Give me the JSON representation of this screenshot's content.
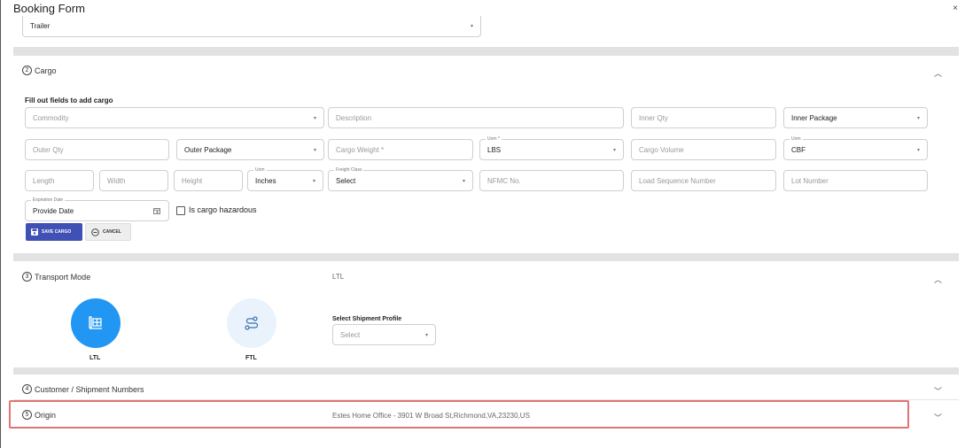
{
  "window": {
    "title": "Booking Form",
    "close": "×"
  },
  "trailer": {
    "value": "Trailer"
  },
  "cargo": {
    "number": "2",
    "title": "Cargo",
    "instructions": "Fill out fields to add cargo",
    "row1": {
      "commodity": "Commodity",
      "description": "Description",
      "inner_qty": "Inner Qty",
      "inner_package": "Inner Package"
    },
    "row2": {
      "outer_qty": "Outer Qty",
      "outer_package": "Outer Package",
      "cargo_weight": "Cargo Weight *",
      "uom_label": "Uom *",
      "uom_value": "LBS",
      "cargo_volume": "Cargo Volume",
      "uom2_label": "Uom",
      "uom2_value": "CBF"
    },
    "row3": {
      "length": "Length",
      "width": "Width",
      "height": "Height",
      "uom_label": "Uom",
      "uom_value": "Inches",
      "freight_class_label": "Freight Class",
      "freight_class_value": "Select",
      "nmfc": "NFMC No.",
      "load_sequence": "Load Sequence Number",
      "lot_number": "Lot Number"
    },
    "expiration": {
      "label": "Expiration Date",
      "value": "Provide Date"
    },
    "hazardous_label": "Is cargo hazardous",
    "save_label": "SAVE CARGO",
    "cancel_label": "CANCEL"
  },
  "transport": {
    "number": "3",
    "title": "Transport Mode",
    "selected": "LTL",
    "ltl_label": "LTL",
    "ftl_label": "FTL",
    "profile_label": "Select Shipment Profile",
    "profile_placeholder": "Select",
    "colors": {
      "ltl_active": "#2196f3",
      "ftl_inactive": "#eaf3fc"
    }
  },
  "customer": {
    "number": "4",
    "title": "Customer / Shipment Numbers"
  },
  "origin": {
    "number": "5",
    "title": "Origin",
    "address": "Estes Home Office - 3901 W Broad St,Richmond,VA,23230,US"
  },
  "chevrons": {
    "up": "︿",
    "down": "﹀",
    "caret": "▾"
  }
}
